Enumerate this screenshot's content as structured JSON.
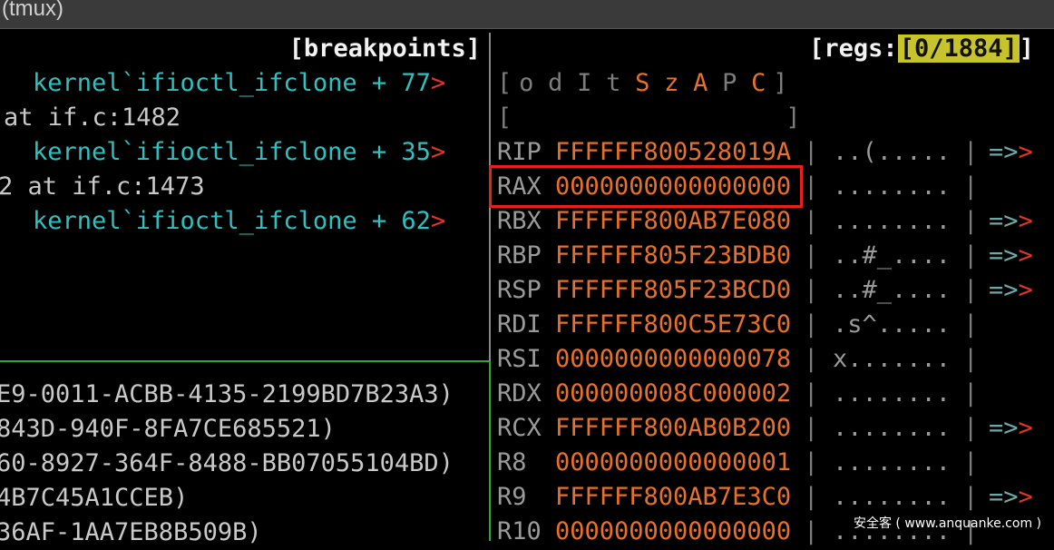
{
  "window": {
    "title": "(tmux)"
  },
  "breakpoints": {
    "header": "[breakpoints]",
    "rows": [
      {
        "text": "kernel`ifioctl_ifclone + 77",
        "arrow": ">"
      },
      {
        "text": "at if.c:1482"
      },
      {
        "text": "kernel`ifioctl_ifclone + 35",
        "arrow": ">"
      },
      {
        "text": "2 at if.c:1473"
      },
      {
        "text": "kernel`ifioctl_ifclone + 62",
        "arrow": ">"
      }
    ]
  },
  "uuid_list": [
    "E9-0011-ACBB-4135-2199BD7B23A3)",
    "843D-940F-8FA7CE685521)",
    "60-8927-364F-8488-BB07055104BD)",
    "4B7C45A1CCEB)",
    "36AF-1AA7EB8B509B)"
  ],
  "regs": {
    "header_prefix": "[regs:",
    "counter": "[0/1884]",
    "header_suffix": "]",
    "flags_open": "[",
    "flags": [
      {
        "ch": "o",
        "active": false
      },
      {
        "ch": "d",
        "active": false
      },
      {
        "ch": "I",
        "active": false
      },
      {
        "ch": "t",
        "active": false
      },
      {
        "ch": "S",
        "active": true
      },
      {
        "ch": "z",
        "active": true
      },
      {
        "ch": "A",
        "active": true
      },
      {
        "ch": "P",
        "active": false
      },
      {
        "ch": "C",
        "active": true
      }
    ],
    "flags_close": "]",
    "empty_open": "[",
    "empty_close": "]",
    "rows": [
      {
        "name": "RIP",
        "value": "FFFFFF800528019A",
        "sep": "|",
        "ascii": "..(.....",
        "sep2": "|",
        "arrow": "=>>"
      },
      {
        "name": "RAX",
        "value": "0000000000000000",
        "sep": "|",
        "ascii": "........",
        "sep2": "|",
        "arrow": ""
      },
      {
        "name": "RBX",
        "value": "FFFFFF800AB7E080",
        "sep": "|",
        "ascii": "........",
        "sep2": "|",
        "arrow": "=>>"
      },
      {
        "name": "RBP",
        "value": "FFFFFF805F23BDB0",
        "sep": "|",
        "ascii": "..#_....",
        "sep2": "|",
        "arrow": "=>>"
      },
      {
        "name": "RSP",
        "value": "FFFFFF805F23BCD0",
        "sep": "|",
        "ascii": "..#_....",
        "sep2": "|",
        "arrow": "=>>"
      },
      {
        "name": "RDI",
        "value": "FFFFFF800C5E73C0",
        "sep": "|",
        "ascii": ".s^.....",
        "sep2": "|",
        "arrow": ""
      },
      {
        "name": "RSI",
        "value": "0000000000000078",
        "sep": "|",
        "ascii": "x.......",
        "sep2": "|",
        "arrow": ""
      },
      {
        "name": "RDX",
        "value": "000000008C000002",
        "sep": "|",
        "ascii": "........",
        "sep2": "|",
        "arrow": ""
      },
      {
        "name": "RCX",
        "value": "FFFFFF800AB0B200",
        "sep": "|",
        "ascii": "........",
        "sep2": "|",
        "arrow": "=>>"
      },
      {
        "name": "R8",
        "value": "0000000000000001",
        "sep": "|",
        "ascii": "........",
        "sep2": "|",
        "arrow": ""
      },
      {
        "name": "R9",
        "value": "FFFFFF800AB7E3C0",
        "sep": "|",
        "ascii": "........",
        "sep2": "|",
        "arrow": "=>>"
      },
      {
        "name": "R10",
        "value": "0000000000000000",
        "sep": "|",
        "ascii": "........",
        "sep2": "|",
        "arrow": ""
      }
    ]
  },
  "watermark": "安全客 ( www.anquanke.com )",
  "colors": {
    "cyan": "#2fc0c0",
    "orange": "#e8702a",
    "red": "#e0342a",
    "highlight": "#e5211b",
    "pane_border": "#2fa82f"
  }
}
